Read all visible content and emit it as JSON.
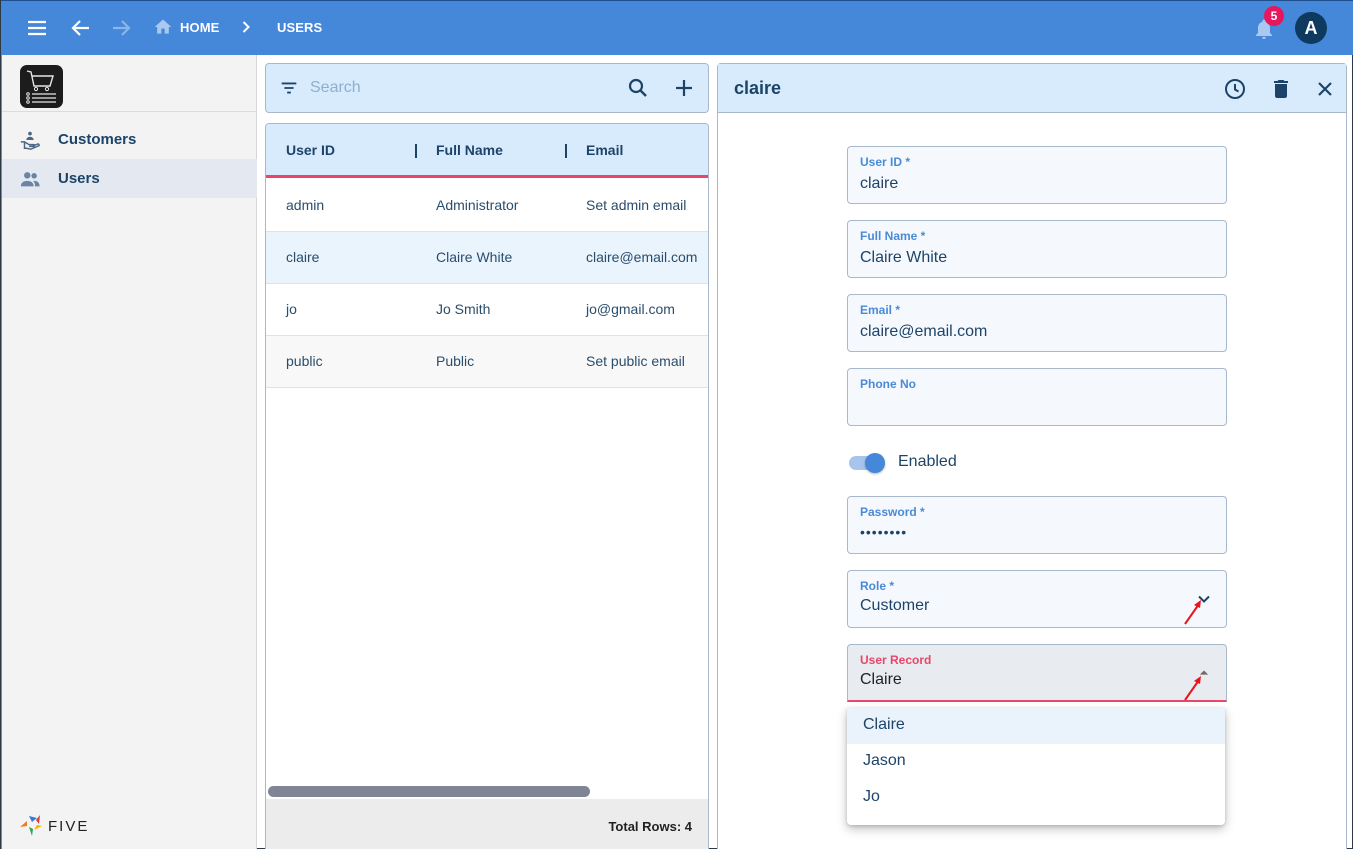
{
  "topbar": {
    "menu_icon": "hamburger-menu-icon",
    "back_icon": "arrow-left-icon",
    "forward_icon": "arrow-right-icon",
    "breadcrumb": [
      {
        "label": "HOME",
        "icon": "home-icon"
      },
      {
        "label": "USERS"
      }
    ],
    "notifications_count": "5",
    "avatar_initial": "A",
    "colors": {
      "bar": "#4587d9",
      "badge": "#e8175d",
      "avatar": "#0e3a5f"
    }
  },
  "sidebar": {
    "logo_icon": "shopping-cart-list-icon",
    "items": [
      {
        "label": "Customers",
        "icon": "customer-service-icon",
        "active": false
      },
      {
        "label": "Users",
        "icon": "users-icon",
        "active": true
      }
    ],
    "brand": "FIVE"
  },
  "list": {
    "search_placeholder": "Search",
    "search_value": "",
    "columns": [
      "User ID",
      "Full Name",
      "Email"
    ],
    "rows": [
      {
        "user_id": "admin",
        "full_name": "Administrator",
        "email": "Set admin email"
      },
      {
        "user_id": "claire",
        "full_name": "Claire White",
        "email": "claire@email.com",
        "selected": true
      },
      {
        "user_id": "jo",
        "full_name": "Jo Smith",
        "email": "jo@gmail.com"
      },
      {
        "user_id": "public",
        "full_name": "Public",
        "email": "Set public email"
      }
    ],
    "total_rows": "Total Rows: 4"
  },
  "detail": {
    "title": "claire",
    "fields": {
      "user_id": {
        "label": "User ID *",
        "value": "claire"
      },
      "full_name": {
        "label": "Full Name *",
        "value": "Claire White"
      },
      "email": {
        "label": "Email *",
        "value": "claire@email.com"
      },
      "phone": {
        "label": "Phone No",
        "value": ""
      },
      "enabled": {
        "label": "Enabled",
        "checked": true
      },
      "password": {
        "label": "Password *",
        "value": "••••••••"
      },
      "role": {
        "label": "Role *",
        "value": "Customer"
      },
      "user_record": {
        "label": "User Record",
        "value": "Claire"
      }
    },
    "user_record_options": [
      "Claire",
      "Jason",
      "Jo"
    ],
    "colors": {
      "accent": "#4587d9",
      "error_focus": "#e8476a",
      "header_bg": "#d7ebfc"
    }
  }
}
